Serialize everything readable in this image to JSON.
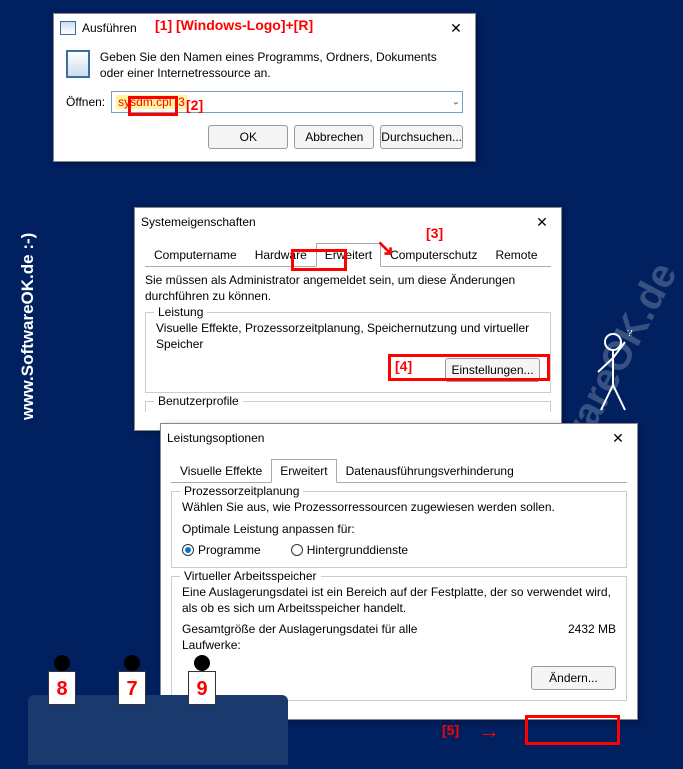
{
  "run": {
    "title": "Ausführen",
    "description": "Geben Sie den Namen eines Programms, Ordners, Dokuments oder einer Internetressource an.",
    "open_label": "Öffnen:",
    "command": "sysdm.cpl ,3",
    "ok": "OK",
    "cancel": "Abbrechen",
    "browse": "Durchsuchen..."
  },
  "sysprops": {
    "title": "Systemeigenschaften",
    "tabs": {
      "t1": "Computername",
      "t2": "Hardware",
      "t3": "Erweitert",
      "t4": "Computerschutz",
      "t5": "Remote"
    },
    "admin_hint": "Sie müssen als Administrator angemeldet sein, um diese Änderungen durchführen zu können.",
    "perf_group": "Leistung",
    "perf_desc": "Visuelle Effekte, Prozessorzeitplanung, Speichernutzung und virtueller Speicher",
    "settings_btn": "Einstellungen...",
    "userprofiles": "Benutzerprofile"
  },
  "perfopt": {
    "title": "Leistungsoptionen",
    "tabs": {
      "t1": "Visuelle Effekte",
      "t2": "Erweitert",
      "t3": "Datenausführungsverhinderung"
    },
    "cpu_group": "Prozessorzeitplanung",
    "cpu_desc": "Wählen Sie aus, wie Prozessorressourcen zugewiesen werden sollen.",
    "cpu_optimal": "Optimale Leistung anpassen für:",
    "radio_programs": "Programme",
    "radio_bg": "Hintergrunddienste",
    "vm_group": "Virtueller Arbeitsspeicher",
    "vm_desc": "Eine Auslagerungsdatei ist ein Bereich auf der Festplatte, der so verwendet wird, als ob es sich um Arbeitsspeicher handelt.",
    "vm_total_label": "Gesamtgröße der Auslagerungsdatei für alle Laufwerke:",
    "vm_total_value": "2432 MB",
    "change_btn": "Ändern..."
  },
  "annotations": {
    "a1": "[1]  [Windows-Logo]+[R]",
    "a2": "[2]",
    "a3": "[3]",
    "a4": "[4]",
    "a5": "[5]"
  },
  "watermark": "www.SoftwareOK.de  :-)",
  "watermark2": "SoftwareOK.de",
  "signs": {
    "n8": "8",
    "n7": "7",
    "n9": "9"
  }
}
